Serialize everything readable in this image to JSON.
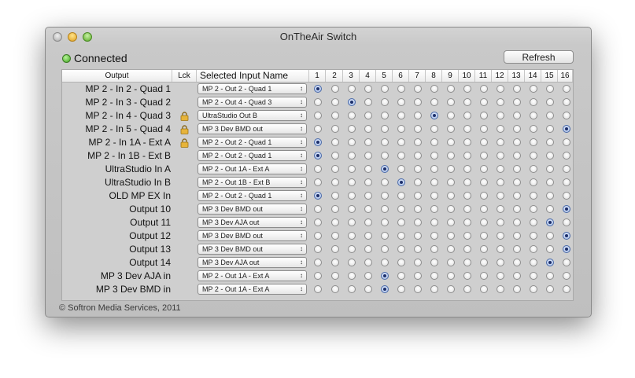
{
  "window": {
    "title": "OnTheAir Switch"
  },
  "status": {
    "text": "Connected",
    "color": "#3da31d"
  },
  "toolbar": {
    "refresh_label": "Refresh"
  },
  "table": {
    "headers": {
      "output": "Output",
      "lock": "Lck",
      "input": "Selected Input Name"
    },
    "columns": [
      "1",
      "2",
      "3",
      "4",
      "5",
      "6",
      "7",
      "8",
      "9",
      "10",
      "11",
      "12",
      "13",
      "14",
      "15",
      "16"
    ],
    "rows": [
      {
        "output": "MP 2 - In 2 - Quad 1",
        "locked": false,
        "input": "MP 2 - Out 2 - Quad 1",
        "selected": 1
      },
      {
        "output": "MP 2 - In 3 - Quad 2",
        "locked": false,
        "input": "MP 2 - Out 4 - Quad 3",
        "selected": 3
      },
      {
        "output": "MP 2 - In 4 - Quad 3",
        "locked": true,
        "input": "UltraStudio Out B",
        "selected": 8
      },
      {
        "output": "MP 2 - In 5 - Quad 4",
        "locked": true,
        "input": "MP 3 Dev BMD out",
        "selected": 16
      },
      {
        "output": "MP 2 - In 1A - Ext A",
        "locked": true,
        "input": "MP 2 - Out 2 - Quad 1",
        "selected": 1
      },
      {
        "output": "MP 2 - In 1B - Ext B",
        "locked": false,
        "input": "MP 2 - Out 2 - Quad 1",
        "selected": 1
      },
      {
        "output": "UltraStudio In A",
        "locked": false,
        "input": "MP 2 - Out 1A - Ext A",
        "selected": 5
      },
      {
        "output": "UltraStudio In B",
        "locked": false,
        "input": "MP 2 - Out 1B - Ext B",
        "selected": 6
      },
      {
        "output": "OLD MP EX In",
        "locked": false,
        "input": "MP 2 - Out 2 - Quad 1",
        "selected": 1
      },
      {
        "output": "Output 10",
        "locked": false,
        "input": "MP 3 Dev BMD out",
        "selected": 16
      },
      {
        "output": "Output 11",
        "locked": false,
        "input": "MP 3 Dev AJA out",
        "selected": 15
      },
      {
        "output": "Output 12",
        "locked": false,
        "input": "MP 3 Dev BMD out",
        "selected": 16
      },
      {
        "output": "Output 13",
        "locked": false,
        "input": "MP 3 Dev BMD out",
        "selected": 16
      },
      {
        "output": "Output 14",
        "locked": false,
        "input": "MP 3 Dev AJA out",
        "selected": 15
      },
      {
        "output": "MP 3 Dev AJA in",
        "locked": false,
        "input": "MP 2 - Out 1A - Ext A",
        "selected": 5
      },
      {
        "output": "MP 3 Dev BMD in",
        "locked": false,
        "input": "MP 2 - Out 1A - Ext A",
        "selected": 5
      }
    ]
  },
  "footer": {
    "copyright": "© Softron Media Services, 2011"
  },
  "icons": {
    "lock": "lock-icon",
    "popup_arrow": "up-down-arrows-icon"
  }
}
